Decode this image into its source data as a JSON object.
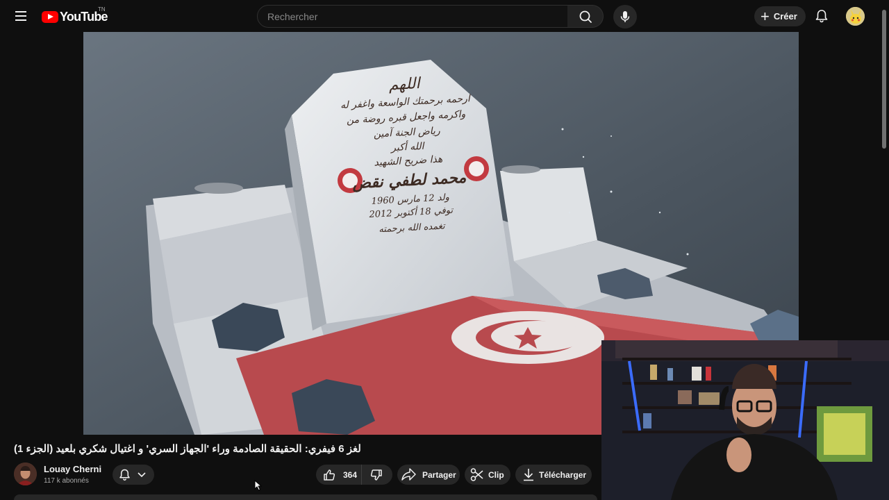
{
  "header": {
    "logo_text": "YouTube",
    "country_code": "TN",
    "search_placeholder": "Rechercher",
    "create_label": "Créer"
  },
  "video": {
    "title": "لغز 6 فيفري: الحقيقة الصادمة وراء 'الجهاز السري' و اغتيال شكري بلعيد (الجزء 1)",
    "gravestone_lines": [
      "اللهم",
      "ارحمه برحمتك الواسعة واغفر له",
      "واكرمه واجعل قبره روضة من",
      "رياض الجنة آمين",
      "الله أكبر",
      "هذا ضريح الشهيد",
      "محمد لطفي نقض",
      "ولد 12 مارس 1960",
      "توفي 18 أكتوبر 2012",
      "تغمده الله برحمته"
    ]
  },
  "channel": {
    "name": "Louay Cherni",
    "subscribers": "117 k abonnés"
  },
  "actions": {
    "like_count": "364",
    "share_label": "Partager",
    "clip_label": "Clip",
    "download_label": "Télécharger"
  },
  "colors": {
    "background": "#0f0f0f",
    "pill": "#272727",
    "brand_red": "#ff0000"
  }
}
